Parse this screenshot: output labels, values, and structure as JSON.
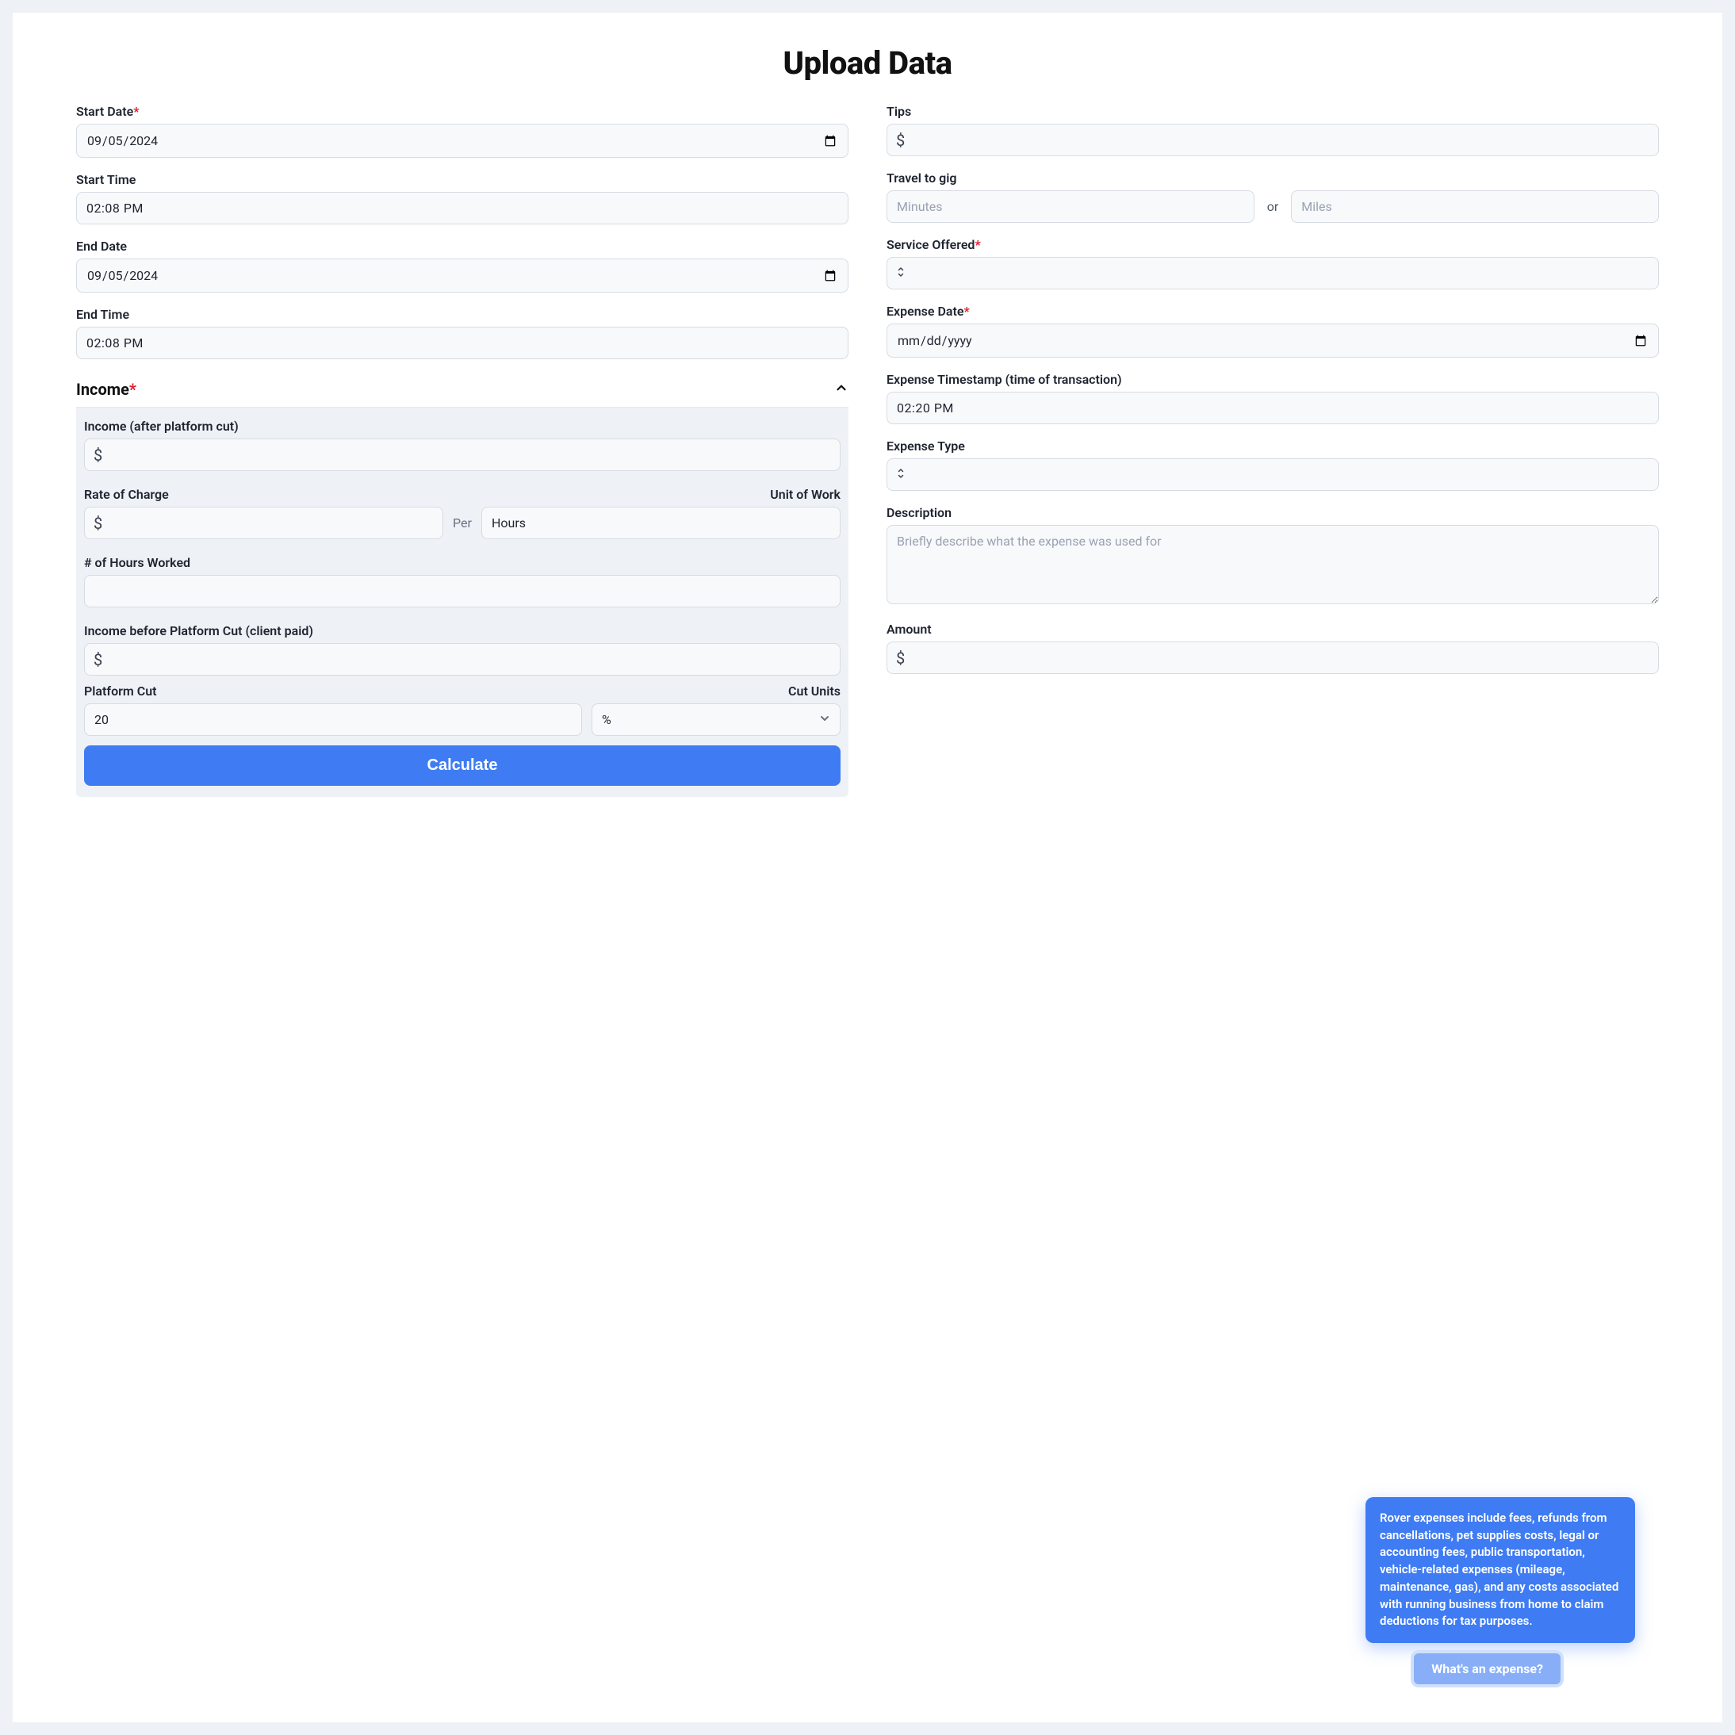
{
  "title": "Upload Data",
  "left": {
    "start_date": {
      "label": "Start Date",
      "required": true,
      "value": "2024-09-05"
    },
    "start_time": {
      "label": "Start Time",
      "value": "02:08 PM"
    },
    "end_date": {
      "label": "End Date",
      "value": "2024-09-05"
    },
    "end_time": {
      "label": "End Time",
      "value": "02:08 PM"
    },
    "income_section": {
      "title": "Income",
      "required": true
    },
    "income_after": {
      "label": "Income (after platform cut)",
      "value": ""
    },
    "rate_label": "Rate of Charge",
    "unit_label": "Unit of Work",
    "per": "Per",
    "unit_value": "Hours",
    "hours_worked": {
      "label": "# of Hours Worked",
      "value": ""
    },
    "income_before": {
      "label": "Income before Platform Cut (client paid)",
      "value": ""
    },
    "platform_cut_label": "Platform Cut",
    "platform_cut_value": "20",
    "cut_units_label": "Cut Units",
    "cut_units_value": "%",
    "calculate": "Calculate"
  },
  "right": {
    "tips_label": "Tips",
    "travel_label": "Travel to gig",
    "minutes_placeholder": "Minutes",
    "or": "or",
    "miles_placeholder": "Miles",
    "service_label": "Service Offered",
    "service_required": true,
    "expense_date": {
      "label": "Expense Date",
      "required": true,
      "placeholder": "mm/dd/yyyy"
    },
    "expense_ts": {
      "label": "Expense Timestamp (time of transaction)",
      "value": "02:20 PM"
    },
    "expense_type_label": "Expense Type",
    "description_label": "Description",
    "description_placeholder": "Briefly describe what the expense was used for",
    "amount_label": "Amount"
  },
  "popover": "Rover expenses include fees, refunds from cancellations, pet supplies costs, legal or accounting fees, public transportation, vehicle-related expenses (mileage, maintenance, gas), and any costs associated with running business from home to claim deductions for tax purposes.",
  "help_chip": "What's an expense?"
}
